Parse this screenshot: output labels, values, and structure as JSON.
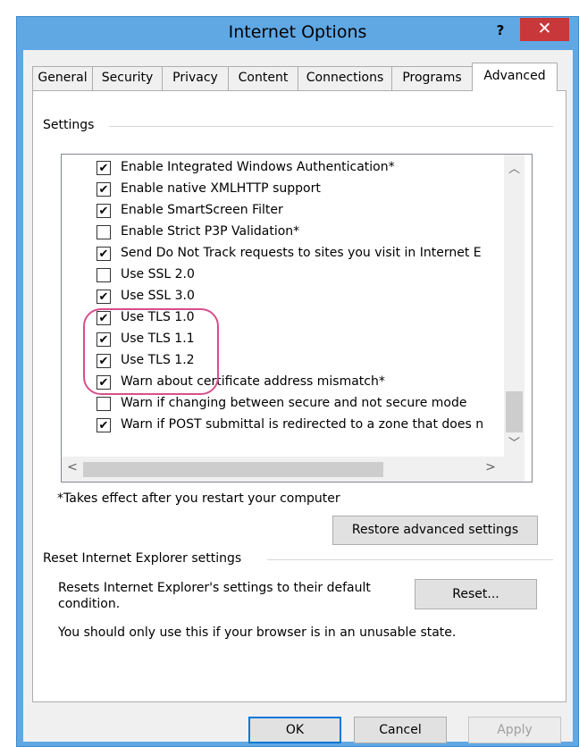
{
  "window": {
    "title": "Internet Options",
    "help_label": "?",
    "close_label": "✕"
  },
  "tabs": [
    {
      "label": "General"
    },
    {
      "label": "Security"
    },
    {
      "label": "Privacy"
    },
    {
      "label": "Content"
    },
    {
      "label": "Connections"
    },
    {
      "label": "Programs"
    },
    {
      "label": "Advanced",
      "active": true
    }
  ],
  "settings_group": {
    "label": "Settings",
    "items": [
      {
        "label": "Enable Integrated Windows Authentication*",
        "checked": true
      },
      {
        "label": "Enable native XMLHTTP support",
        "checked": true
      },
      {
        "label": "Enable SmartScreen Filter",
        "checked": true
      },
      {
        "label": "Enable Strict P3P Validation*",
        "checked": false
      },
      {
        "label": "Send Do Not Track requests to sites you visit in Internet E",
        "checked": true
      },
      {
        "label": "Use SSL 2.0",
        "checked": false
      },
      {
        "label": "Use SSL 3.0",
        "checked": true
      },
      {
        "label": "Use TLS 1.0",
        "checked": true
      },
      {
        "label": "Use TLS 1.1",
        "checked": true
      },
      {
        "label": "Use TLS 1.2",
        "checked": true
      },
      {
        "label": "Warn about certificate address mismatch*",
        "checked": true
      },
      {
        "label": "Warn if changing between secure and not secure mode",
        "checked": false
      },
      {
        "label": "Warn if POST submittal is redirected to a zone that does n",
        "checked": true
      }
    ],
    "check_glyph": "✔",
    "scroll": {
      "up": "︿",
      "down": "﹀",
      "left": "<",
      "right": ">"
    },
    "restart_note": "*Takes effect after you restart your computer",
    "restore_button": "Restore advanced settings"
  },
  "reset_group": {
    "label": "Reset Internet Explorer settings",
    "description_line1": "Resets Internet Explorer's settings to their default",
    "description_line2": "condition.",
    "reset_button": "Reset...",
    "warning": "You should only use this if your browser is in an unusable state."
  },
  "footer": {
    "ok": "OK",
    "cancel": "Cancel",
    "apply": "Apply"
  },
  "colors": {
    "title_bar": "#5fa8e4",
    "close_button": "#c8373a",
    "highlight": "#d84f8a"
  }
}
